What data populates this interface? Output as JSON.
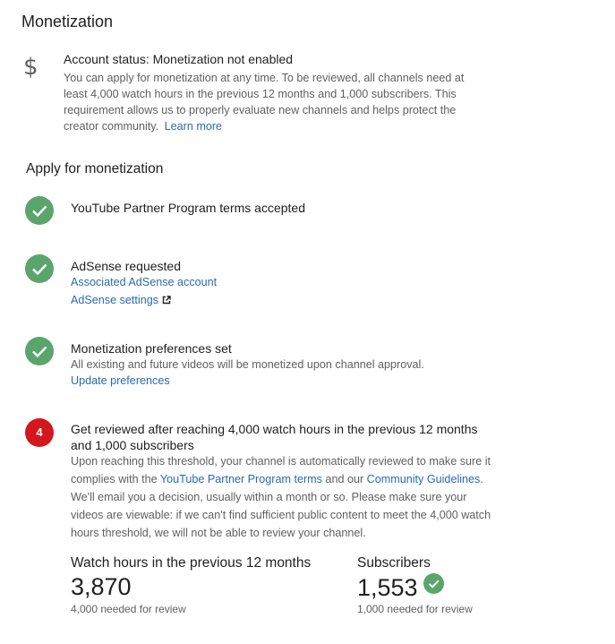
{
  "page": {
    "title": "Monetization"
  },
  "account": {
    "icon": "dollar-icon",
    "status": "Account status: Monetization not enabled",
    "description": "You can apply for monetization at any time. To be reviewed, all channels need at least 4,000 watch hours in the previous 12 months and 1,000 subscribers. This requirement allows us to properly evaluate new channels and helps protect the creator community.",
    "learn_more": "Learn more"
  },
  "apply": {
    "heading": "Apply for monetization",
    "steps": [
      {
        "status": "done",
        "title": "YouTube Partner Program terms accepted"
      },
      {
        "status": "done",
        "title": "AdSense requested",
        "links": [
          "Associated AdSense account",
          "AdSense settings"
        ]
      },
      {
        "status": "done",
        "title": "Monetization preferences set",
        "description": "All existing and future videos will be monetized upon channel approval.",
        "links": [
          "Update preferences"
        ]
      },
      {
        "status": "pending",
        "number": "4",
        "title": "Get reviewed after reaching 4,000 watch hours in the previous 12 months and 1,000 subscribers",
        "desc_part1": "Upon reaching this threshold, your channel is automatically reviewed to make sure it complies with the ",
        "link_ypp": "YouTube Partner Program terms",
        "desc_part2": " and our ",
        "link_guidelines": "Community Guidelines",
        "desc_part3": ". We'll email you a decision, usually within a month or so. Please make sure your videos are viewable: if we can't find sufficient public content to meet the 4,000 watch hours threshold, we will not be able to review your channel."
      }
    ]
  },
  "stats": {
    "watch_hours": {
      "label": "Watch hours in the previous 12 months",
      "value": "3,870",
      "needed": "4,000 needed for review"
    },
    "subscribers": {
      "label": "Subscribers",
      "value": "1,553",
      "needed": "1,000 needed for review",
      "met": true
    }
  },
  "colors": {
    "check_green": "#5aa56b",
    "badge_red": "#d2181c",
    "link_blue": "#2b6ab0"
  }
}
